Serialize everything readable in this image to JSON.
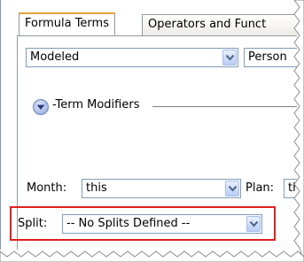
{
  "tabs": [
    {
      "label": "Formula Terms",
      "active": true
    },
    {
      "label": "Operators and Funct",
      "active": false
    }
  ],
  "row1": {
    "combo1_value": "Modeled",
    "combo2_value": "Person"
  },
  "modifiers": {
    "label": "-Term Modifiers"
  },
  "month": {
    "label": "Month:",
    "value": "this"
  },
  "plan": {
    "label": "Plan:",
    "value": "this"
  },
  "split": {
    "label": "Split:",
    "value": "-- No Splits Defined --"
  },
  "colors": {
    "highlight": "#e02020",
    "combo_border": "#7f9db9",
    "tab_accent": "#e7a33a"
  },
  "icons": {
    "dropdown": "chevron-down-icon",
    "collapse": "expand-circle-icon"
  }
}
